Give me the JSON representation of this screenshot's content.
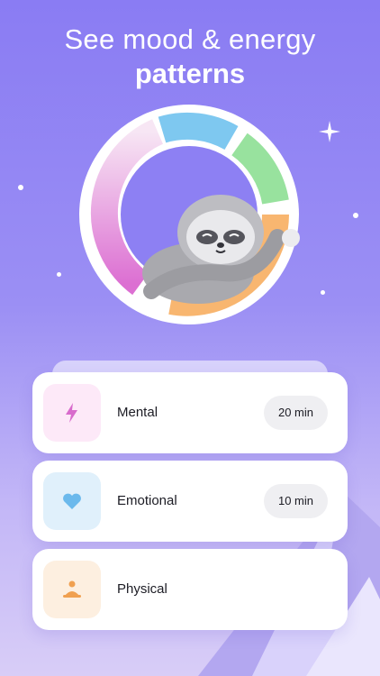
{
  "header": {
    "title_line1": "See mood & energy",
    "title_line2": "patterns"
  },
  "colors": {
    "background_top": "#8a7cf3",
    "ring_pink": "#e07ad8",
    "ring_blue": "#7ec8f0",
    "ring_green": "#98e29e",
    "ring_orange": "#f8b670"
  },
  "cards": [
    {
      "label": "Mental",
      "duration": "20 min",
      "icon": "lightning-icon",
      "icon_bg": "#fde9f8",
      "icon_color": "#d86bcc"
    },
    {
      "label": "Emotional",
      "duration": "10 min",
      "icon": "heart-icon",
      "icon_bg": "#e0f0fb",
      "icon_color": "#6bb9ec"
    },
    {
      "label": "Physical",
      "duration": "",
      "icon": "meditation-icon",
      "icon_bg": "#fdefe0",
      "icon_color": "#f0a050"
    }
  ]
}
